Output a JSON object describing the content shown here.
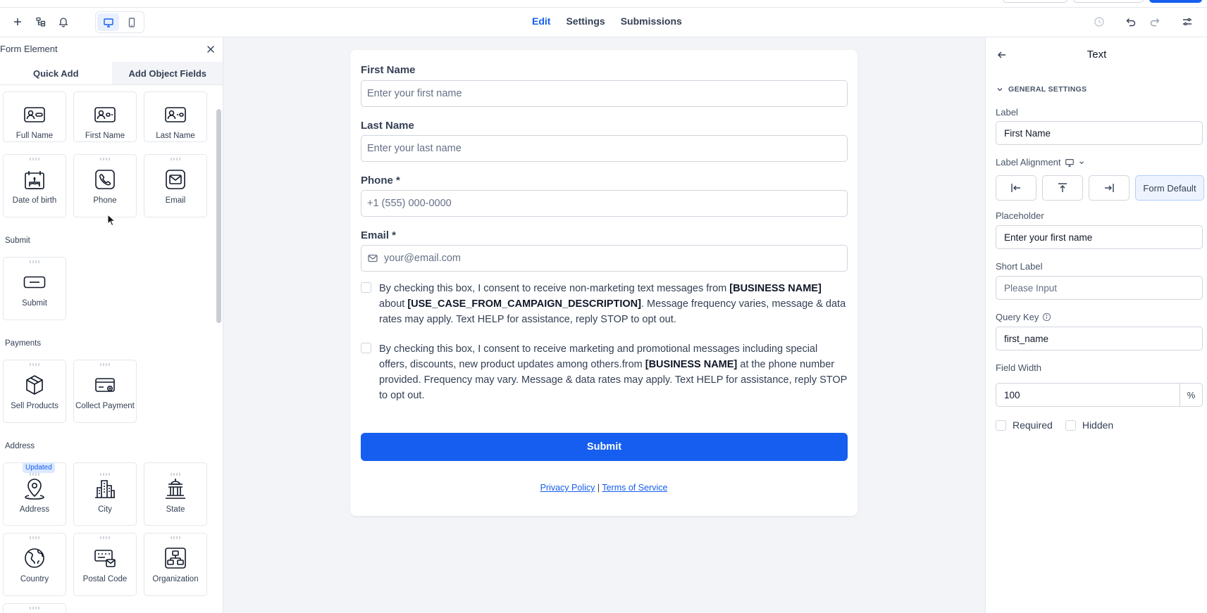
{
  "top_tabs": [
    {
      "label": "Edit",
      "active": true
    },
    {
      "label": "Settings",
      "active": false
    },
    {
      "label": "Submissions",
      "active": false
    }
  ],
  "left_panel": {
    "title": "Form Element",
    "tabs": [
      {
        "label": "Quick Add",
        "active": false
      },
      {
        "label": "Add Object Fields",
        "active": true
      }
    ],
    "tiles_top": [
      {
        "label": "Full Name",
        "icon": "id-card-icon"
      },
      {
        "label": "First Name",
        "icon": "id-card-icon"
      },
      {
        "label": "Last Name",
        "icon": "id-card-icon"
      },
      {
        "label": "Date of birth",
        "icon": "birthday-cake-icon"
      },
      {
        "label": "Phone",
        "icon": "phone-icon"
      },
      {
        "label": "Email",
        "icon": "mail-icon"
      }
    ],
    "sections": {
      "submit": "Submit",
      "payments": "Payments",
      "address": "Address"
    },
    "submit_tiles": [
      {
        "label": "Submit",
        "icon": "button-icon"
      }
    ],
    "payment_tiles": [
      {
        "label": "Sell Products",
        "icon": "box-icon"
      },
      {
        "label": "Collect Payment",
        "icon": "card-icon"
      }
    ],
    "address_tiles": [
      {
        "label": "Address",
        "icon": "map-pin-icon",
        "badge": "Updated"
      },
      {
        "label": "City",
        "icon": "city-icon"
      },
      {
        "label": "State",
        "icon": "state-building-icon"
      },
      {
        "label": "Country",
        "icon": "globe-icon"
      },
      {
        "label": "Postal Code",
        "icon": "postal-code-icon"
      },
      {
        "label": "Organization",
        "icon": "organization-icon"
      }
    ]
  },
  "form": {
    "first_name": {
      "label": "First Name",
      "placeholder": "Enter your first name"
    },
    "last_name": {
      "label": "Last Name",
      "placeholder": "Enter your last name"
    },
    "phone": {
      "label": "Phone *",
      "placeholder": "+1 (555) 000-0000"
    },
    "email": {
      "label": "Email *",
      "placeholder": "your@email.com"
    },
    "consent1": {
      "p1": "By checking this box, I consent to receive non-marketing text messages from ",
      "b1": "[BUSINESS NAME]",
      "p2": " about ",
      "b2": "[USE_CASE_FROM_CAMPAIGN_DESCRIPTION]",
      "p3": ". Message frequency varies, message & data rates may apply. Text HELP for assistance, reply STOP to opt out."
    },
    "consent2": {
      "p1": "By checking this box, I consent to receive marketing and promotional messages including special offers, discounts, new product updates among others.from ",
      "b1": "[BUSINESS NAME]",
      "p2": " at the phone number provided. Frequency may vary. Message & data rates may apply. Text HELP for assistance, reply STOP to opt out."
    },
    "submit_label": "Submit",
    "privacy": "Privacy Policy",
    "separator": "|",
    "terms": "Terms of Service"
  },
  "right_panel": {
    "title": "Text",
    "section": "GENERAL SETTINGS",
    "label_label": "Label",
    "label_value": "First Name",
    "label_alignment": "Label Alignment",
    "form_default": "Form Default",
    "placeholder_label": "Placeholder",
    "placeholder_value": "Enter your first name",
    "short_label": "Short Label",
    "short_label_placeholder": "Please Input",
    "query_key_label": "Query Key",
    "query_key_value": "first_name",
    "field_width_label": "Field Width",
    "field_width_value": "100",
    "field_width_unit": "%",
    "required": "Required",
    "hidden": "Hidden"
  },
  "colors": {
    "accent": "#155eef",
    "canvas": "#f2f4f7"
  }
}
